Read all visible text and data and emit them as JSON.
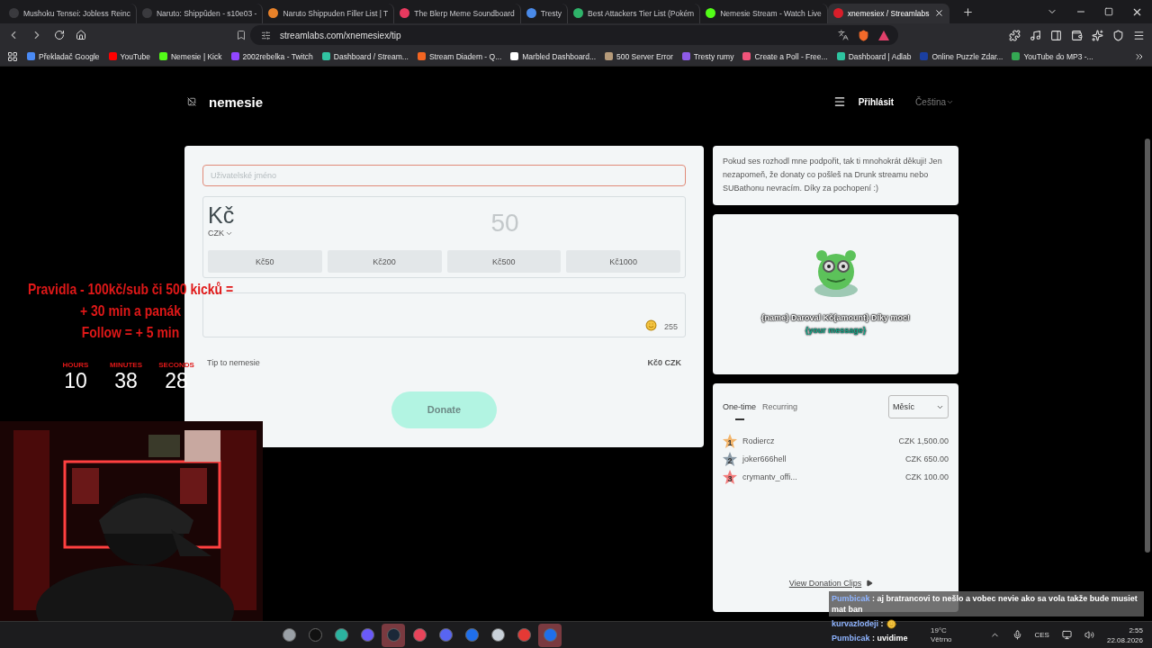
{
  "browser": {
    "tabs": [
      {
        "title": "Mushoku Tensei: Jobless Reinc",
        "color": "#3a3a3e",
        "selected": false
      },
      {
        "title": "Naruto: Shippûden - s10e03 -",
        "color": "#3a3a3e",
        "selected": false
      },
      {
        "title": "Naruto Shippuden Filler List | T",
        "color": "#e8822a",
        "selected": false
      },
      {
        "title": "The Blerp Meme Soundboard",
        "color": "#e83a5f",
        "selected": false
      },
      {
        "title": "Tresty",
        "color": "#4a8ae8",
        "selected": false
      },
      {
        "title": "Best Attackers Tier List (Pokém",
        "color": "#2fb36a",
        "selected": false
      },
      {
        "title": "Nemesie Stream - Watch Live",
        "color": "#53fc18",
        "selected": false
      },
      {
        "title": "xnemesiex / Streamlabs",
        "color": "#d81e2a",
        "selected": true
      }
    ],
    "url": "streamlabs.com/xnemesiex/tip",
    "bookmarks": [
      {
        "label": "Překladač Google",
        "color": "#4a8af4"
      },
      {
        "label": "YouTube",
        "color": "#ff0000"
      },
      {
        "label": "Nemesie | Kick",
        "color": "#53fc18"
      },
      {
        "label": "2002rebelka - Twitch",
        "color": "#9146ff"
      },
      {
        "label": "Dashboard / Stream...",
        "color": "#31c3a2"
      },
      {
        "label": "Stream Diadem - Q...",
        "color": "#f26522"
      },
      {
        "label": "Marbled Dashboard...",
        "color": "#ffffff"
      },
      {
        "label": "500 Server Error",
        "color": "#b59a7a"
      },
      {
        "label": "Tresty rumy",
        "color": "#8e5be8"
      },
      {
        "label": "Create a Poll - Free...",
        "color": "#f0547a"
      },
      {
        "label": "Dashboard | Adlab",
        "color": "#2ec4a0"
      },
      {
        "label": "Online Puzzle Zdar...",
        "color": "#1b3fa0"
      },
      {
        "label": "YouTube do MP3 -...",
        "color": "#34a853"
      }
    ]
  },
  "header": {
    "site_name": "nemesie",
    "login": "Přihlásit",
    "language": "Čeština"
  },
  "form": {
    "name_placeholder": "Uživatelské jméno",
    "currency_symbol": "Kč",
    "currency": "CZK",
    "amount_placeholder": "50",
    "presets": [
      "Kč50",
      "Kč200",
      "Kč500",
      "Kč1000"
    ],
    "char_count": "255",
    "tip_label": "Tip to nemesie",
    "total": "Kč0 CZK",
    "donate": "Donate"
  },
  "info": "Pokud ses rozhodl mne podpořit, tak ti mnohokrát děkuji! Jen nezapomeň, že donaty co pošleš na Drunk streamu nebo SUBathonu nevracím. Díky za pochopení :)",
  "alert_preview": {
    "line_1": "{name} Daroval Kč{amount} Díky moc!",
    "line_2": "{your message}"
  },
  "leaderboard": {
    "tabs": [
      {
        "label": "One-time",
        "selected": true
      },
      {
        "label": "Recurring",
        "selected": false
      }
    ],
    "period": "Měsíc",
    "rows": [
      {
        "rank": "1",
        "name": "Rodiercz",
        "amount": "CZK 1,500.00",
        "color": "#f2b46a"
      },
      {
        "rank": "2",
        "name": "joker666hell",
        "amount": "CZK 650.00",
        "color": "#8a9aa6"
      },
      {
        "rank": "3",
        "name": "crymantv_offi...",
        "amount": "CZK 100.00",
        "color": "#f27a7a"
      }
    ],
    "clips_link": "View Donation Clips"
  },
  "stream_overlay": {
    "rules": [
      "Pravidla - 100kč/sub či 500 kicků =",
      "+ 30 min a panák",
      "Follow = + 5 min"
    ],
    "countdown": [
      {
        "label": "HOURS",
        "value": "10"
      },
      {
        "label": "MINUTES",
        "value": "38"
      },
      {
        "label": "SECONDS",
        "value": "28"
      }
    ],
    "webcam": {
      "kind": "picture"
    },
    "chat": [
      {
        "user": "Pumbicak",
        "text": ": aj bratrancovi to nešlo a vobec nevie ako sa vola takže bude musiet mat ban"
      },
      {
        "user": "kurvazlodeji",
        "text": ":"
      },
      {
        "user": "Pumbicak",
        "text": ": uvidime"
      }
    ]
  },
  "taskbar": {
    "apps": [
      {
        "color": "#9aa0a6",
        "selected": false
      },
      {
        "color": "#111111",
        "selected": false
      },
      {
        "color": "#2bb3a0",
        "selected": false
      },
      {
        "color": "#6a5af9",
        "selected": false
      },
      {
        "color": "#1b2838",
        "selected": true
      },
      {
        "color": "#e8445a",
        "selected": false
      },
      {
        "color": "#5865f2",
        "selected": false
      },
      {
        "color": "#1f6feb",
        "selected": false
      },
      {
        "color": "#c9d1d9",
        "selected": false
      },
      {
        "color": "#e53935",
        "selected": false
      },
      {
        "color": "#1f6feb",
        "selected": true
      }
    ],
    "weather": {
      "temperature": "19°C",
      "condition": "Větrno"
    },
    "input_language": "CES",
    "time": "2:55",
    "date": "22.08.2026"
  }
}
